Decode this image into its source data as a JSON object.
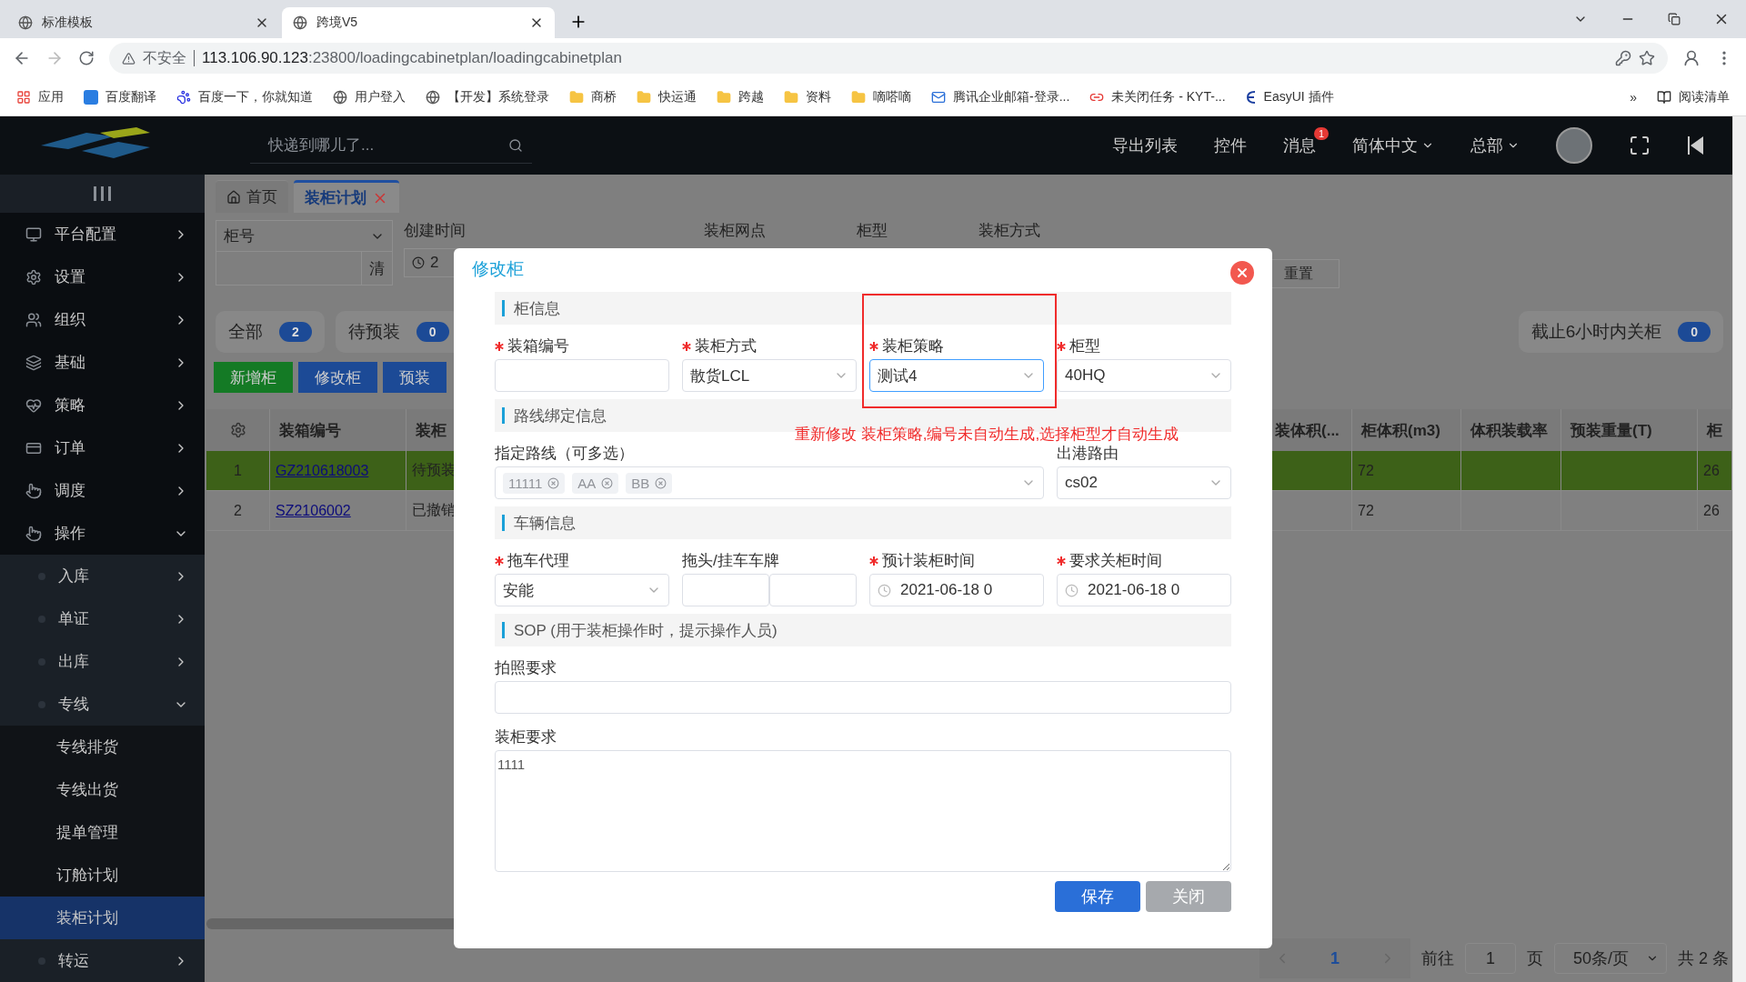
{
  "browser": {
    "tabs": [
      {
        "title": "标准模板",
        "selected": false
      },
      {
        "title": "跨境V5",
        "selected": true
      }
    ],
    "security": "不安全",
    "url_host": "113.106.90.123",
    "url_rest": ":23800/loadingcabinetplan/loadingcabinetplan",
    "bookmarks": [
      {
        "label": "应用",
        "kind": "apps"
      },
      {
        "label": "百度翻译",
        "kind": "app"
      },
      {
        "label": "百度一下，你就知道",
        "kind": "paw"
      },
      {
        "label": "用户登入",
        "kind": "globe"
      },
      {
        "label": "【开发】系统登录",
        "kind": "globe"
      },
      {
        "label": "商桥",
        "kind": "folder"
      },
      {
        "label": "快运通",
        "kind": "folder"
      },
      {
        "label": "跨越",
        "kind": "folder"
      },
      {
        "label": "资料",
        "kind": "folder"
      },
      {
        "label": "嘀嗒嘀",
        "kind": "folder"
      },
      {
        "label": "腾讯企业邮箱-登录...",
        "kind": "mail"
      },
      {
        "label": "未关闭任务 - KYT-...",
        "kind": "arc"
      },
      {
        "label": "EasyUI 插件",
        "kind": "script"
      }
    ],
    "more": "»",
    "reading_list": "阅读清单"
  },
  "header": {
    "search_placeholder": "快递到哪儿了...",
    "links": [
      "导出列表",
      "控件"
    ],
    "messages": {
      "label": "消息",
      "badge": "1"
    },
    "language": "简体中文",
    "org": "总部"
  },
  "sidebar": {
    "items": [
      {
        "label": "平台配置",
        "selected": false,
        "expanded": false
      },
      {
        "label": "设置",
        "selected": false,
        "expanded": false
      },
      {
        "label": "组织",
        "selected": false,
        "expanded": false
      },
      {
        "label": "基础",
        "selected": false,
        "expanded": false
      },
      {
        "label": "策略",
        "selected": false,
        "expanded": false
      },
      {
        "label": "订单",
        "selected": false,
        "expanded": false
      },
      {
        "label": "调度",
        "selected": false,
        "expanded": false
      },
      {
        "label": "操作",
        "selected": false,
        "expanded": true,
        "children": [
          {
            "label": "入库",
            "selected": false,
            "expanded": false
          },
          {
            "label": "单证",
            "selected": false,
            "expanded": false
          },
          {
            "label": "出库",
            "selected": false,
            "expanded": false
          },
          {
            "label": "专线",
            "selected": false,
            "expanded": true,
            "children": [
              {
                "label": "专线排货",
                "selected": false
              },
              {
                "label": "专线出货",
                "selected": false
              },
              {
                "label": "提单管理",
                "selected": false
              },
              {
                "label": "订舱计划",
                "selected": false
              },
              {
                "label": "装柜计划",
                "selected": true
              }
            ]
          },
          {
            "label": "转运",
            "selected": false,
            "expanded": false
          }
        ]
      }
    ]
  },
  "page_tabs": [
    {
      "label": "首页",
      "selected": false,
      "kind": "home"
    },
    {
      "label": "装柜计划",
      "selected": true,
      "kind": "page"
    }
  ],
  "filters": {
    "field_select": "柜号",
    "clear_button": "清",
    "labels": [
      "创建时间",
      "装柜网点",
      "柜型",
      "装柜方式"
    ],
    "date_value": "2",
    "reset_button": "重置"
  },
  "status_pills": [
    {
      "label": "全部",
      "count": "2"
    },
    {
      "label": "待预装",
      "count": "0"
    }
  ],
  "deadline_pill": {
    "label": "截止6小时内关柜",
    "count": "0"
  },
  "actions": [
    {
      "label": "新增柜",
      "kind": "success"
    },
    {
      "label": "修改柜",
      "kind": "primary"
    },
    {
      "label": "预装",
      "kind": "primary"
    }
  ],
  "table": {
    "columns": [
      "装箱编号",
      "装柜",
      "装体积(...",
      "柜体积(m3)",
      "体积装载率",
      "预装重量(T)",
      "柜"
    ],
    "rows": [
      {
        "index": "1",
        "code": "GZ210618003",
        "status": "待预装",
        "cabinet_volume": "72",
        "column_8": "26",
        "selected": true
      },
      {
        "index": "2",
        "code": "SZ2106002",
        "status": "已撤销",
        "cabinet_volume": "72",
        "column_8": "26",
        "selected": false
      }
    ]
  },
  "pagination": {
    "page": "1",
    "goto_label": "前往",
    "goto_value": "1",
    "page_unit": "页",
    "page_size": "50条/页",
    "total": "共 2 条"
  },
  "dialog": {
    "title": "修改柜",
    "sections": [
      {
        "title": "柜信息",
        "fields": [
          {
            "label": "装箱编号",
            "required": true,
            "kind": "input",
            "highlighted": false
          },
          {
            "label": "装柜方式",
            "required": true,
            "kind": "select",
            "value": "散货LCL",
            "highlighted": false
          },
          {
            "label": "装柜策略",
            "required": true,
            "kind": "select",
            "value": "测试4",
            "highlighted": true
          },
          {
            "label": "柜型",
            "required": true,
            "kind": "select",
            "value": "40HQ",
            "highlighted": false
          }
        ]
      },
      {
        "title": "路线绑定信息",
        "note": "重新修改 装柜策略,编号未自动生成,选择柜型才自动生成",
        "fields": [
          {
            "label": "指定路线（可多选）",
            "required": false,
            "kind": "multiselect",
            "tags": [
              "11111",
              "AA",
              "BB"
            ],
            "highlighted": false
          },
          {
            "label": "出港路由",
            "required": false,
            "kind": "select",
            "value": "cs02",
            "highlighted": false
          }
        ]
      },
      {
        "title": "车辆信息",
        "fields": [
          {
            "label": "拖车代理",
            "required": true,
            "kind": "select",
            "value": "安能",
            "highlighted": false
          },
          {
            "label": "拖头/挂车车牌",
            "required": false,
            "kind": "double-input",
            "highlighted": false
          },
          {
            "label": "预计装柜时间",
            "required": true,
            "kind": "date",
            "value": "2021-06-18 0",
            "highlighted": false
          },
          {
            "label": "要求关柜时间",
            "required": true,
            "kind": "date",
            "value": "2021-06-18 0",
            "highlighted": false
          }
        ]
      },
      {
        "title": "SOP (用于装柜操作时，提示操作人员)",
        "fields": [
          {
            "label": "拍照要求",
            "required": false,
            "kind": "wide-input",
            "highlighted": false
          },
          {
            "label": "装柜要求",
            "required": false,
            "kind": "textarea",
            "value": "1111",
            "highlighted": false
          }
        ]
      }
    ],
    "buttons": [
      {
        "label": "保存",
        "kind": "primary"
      },
      {
        "label": "关闭",
        "kind": "secondary"
      }
    ]
  }
}
